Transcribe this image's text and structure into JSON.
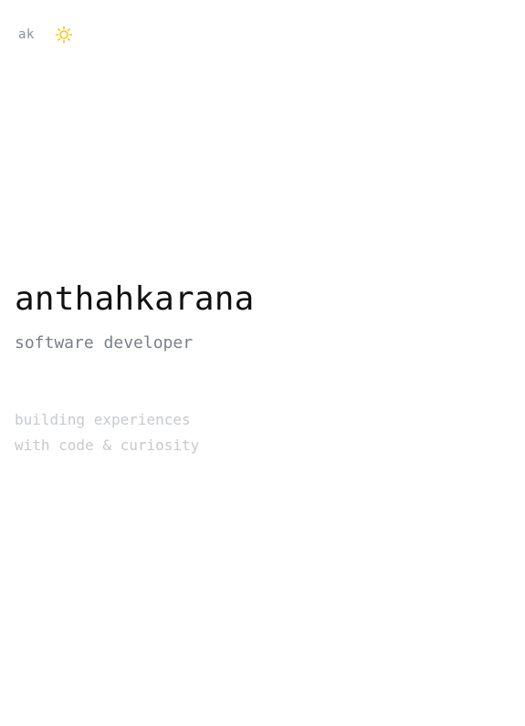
{
  "header": {
    "logo_text": "ak",
    "theme_icon": "sun-icon",
    "theme_color": "#f5c518"
  },
  "hero": {
    "name": "anthahkarana",
    "role": "software developer"
  },
  "tagline": {
    "line1": "building experiences",
    "line2": "with code & curiosity"
  }
}
